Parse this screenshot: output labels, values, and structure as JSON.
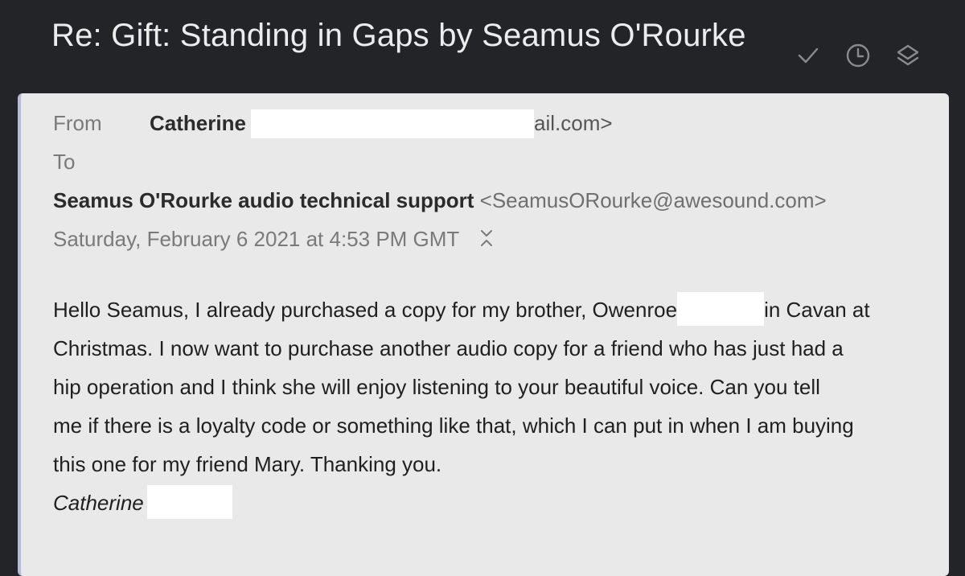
{
  "subject": "Re: Gift: Standing in Gaps by Seamus O'Rourke",
  "toolbar": {
    "icons": [
      "check-icon",
      "clock-icon",
      "layers-icon"
    ]
  },
  "header": {
    "from_label": "From",
    "sender_name": "Catherine",
    "sender_email_tail": "ail.com>",
    "to_label": "To",
    "recipient_name": "Seamus O'Rourke audio technical support",
    "recipient_email": "<SeamusORourke@awesound.com>",
    "date": "Saturday, February 6 2021 at 4:53 PM GMT"
  },
  "body": {
    "line1_a": "Hello Seamus,  I already purchased a copy for my brother, Owenroe",
    "line1_b": "in Cavan at",
    "line2": "Christmas.  I now want to purchase another audio copy for a friend who has just had a",
    "line3": "hip operation and  I think she will enjoy listening to your beautiful voice.   Can you tell",
    "line4": "me if there is a loyalty code or something like that, which I can put in when I am buying",
    "line5": "this one for my friend Mary.   Thanking you.",
    "signature": "Catherine"
  }
}
